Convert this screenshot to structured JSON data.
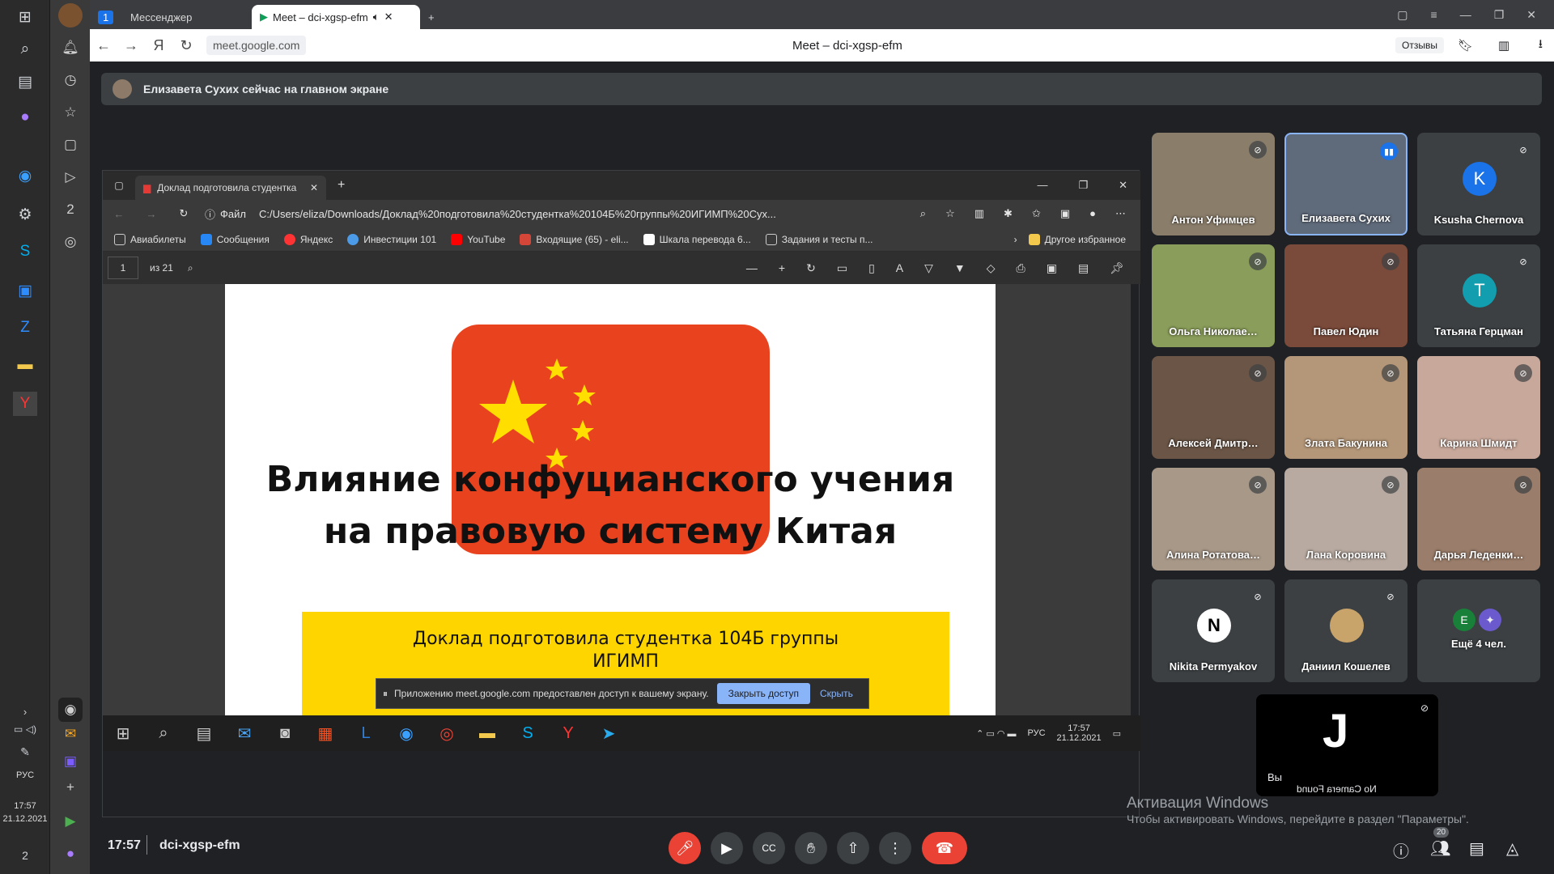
{
  "windows_taskbar": {
    "lang": "РУС",
    "time": "17:57",
    "date": "21.12.2021",
    "notifications": "2"
  },
  "browser": {
    "tabs": [
      {
        "label": "1"
      },
      {
        "label": "Мессенджер"
      },
      {
        "label": "Meet – dci-xgsp-efm"
      }
    ],
    "address": "meet.google.com",
    "page_title": "Meet – dci-xgsp-efm",
    "reviews": "Отзывы"
  },
  "meet": {
    "banner": "Елизавета Сухих сейчас на главном экране",
    "meeting_time": "17:57",
    "meeting_code": "dci-xgsp-efm",
    "people_count": "20",
    "participants": [
      {
        "name": "Антон Уфимцев"
      },
      {
        "name": "Елизавета Сухих"
      },
      {
        "name": "Ksusha Chernova",
        "initial": "K",
        "color": "#1a73e8"
      },
      {
        "name": "Ольга Николае…"
      },
      {
        "name": "Павел Юдин"
      },
      {
        "name": "Татьяна Герцман",
        "initial": "T",
        "color": "#129eaf"
      },
      {
        "name": "Алексей Дмитр…"
      },
      {
        "name": "Злата Бакунина"
      },
      {
        "name": "Карина Шмидт"
      },
      {
        "name": "Алина Ротатова…"
      },
      {
        "name": "Лана Коровина"
      },
      {
        "name": "Дарья Леденки…"
      },
      {
        "name": "Nikita Permyakov"
      },
      {
        "name": "Даниил Кошелев"
      },
      {
        "name": "Ещё 4 чел.",
        "initial": "E"
      }
    ],
    "self": {
      "label": "Вы",
      "camera": "No Camera Found"
    }
  },
  "shared_screen": {
    "tab_title": "Доклад подготовила студентка",
    "file_label": "Файл",
    "path": "C:/Users/eliza/Downloads/Доклад%20подготовила%20студентка%20104Б%20группы%20ИГИМП%20Сух...",
    "favorites": [
      "Авиабилеты",
      "Сообщения",
      "Яндекс",
      "Инвестиции 101",
      "YouTube",
      "Входящие (65) - eli...",
      "Шкала перевода 6...",
      "Задания и тесты п..."
    ],
    "other_favorites": "Другое избранное",
    "page_num": "1",
    "page_total": "из 21",
    "slide_title_line1": "Влияние конфуцианского учения",
    "slide_title_line2": "на правовую систему Китая",
    "report_line1": "Доклад подготовила студентка 104Б группы",
    "report_line2": "ИГИМП",
    "share_notice": "Приложению meet.google.com предоставлен доступ к вашему экрану.",
    "close_access": "Закрыть доступ",
    "hide": "Скрыть",
    "inner_lang": "РУС",
    "inner_time": "17:57",
    "inner_date": "21.12.2021"
  },
  "watermark": {
    "title": "Активация Windows",
    "sub": "Чтобы активировать Windows, перейдите в раздел \"Параметры\"."
  }
}
